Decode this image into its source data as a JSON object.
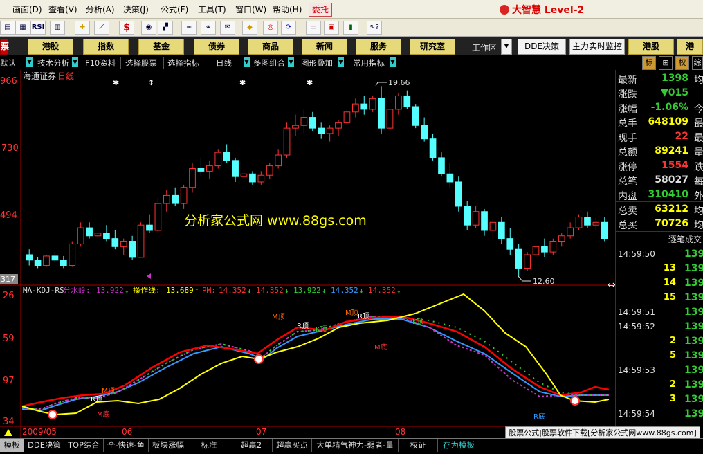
{
  "menu": {
    "items": [
      "画面(D)",
      "查看(V)",
      "分析(A)",
      "决策(J)",
      "公式(F)",
      "工具(T)",
      "窗口(W)",
      "帮助(H)"
    ],
    "weituo": "委托",
    "brand": "大智慧 Level-2"
  },
  "toolbar": {
    "icons": [
      "print-icon",
      "quote-icon",
      "rsi-icon",
      "grid-icon",
      "move-icon",
      "ruler-icon",
      "money-icon",
      "f10-icon",
      "pattern-icon",
      "binoculars-icon",
      "link-icon",
      "chat-icon",
      "stock-icon",
      "diamond-icon",
      "target-icon",
      "refresh-icon",
      "pad-icon",
      "panel-icon",
      "books-icon",
      "pointer-help-icon"
    ],
    "labels": {
      "rsi": "RSI",
      "money": "$"
    }
  },
  "nav": {
    "left_stub": "票",
    "buttons": [
      "港股",
      "指数",
      "基金",
      "债券",
      "商品",
      "新闻",
      "服务",
      "研究室"
    ],
    "workspace_label": "工作区",
    "dde": "DDE决策",
    "monitor": "主力实时监控",
    "hk": "港股",
    "hk2": "港"
  },
  "subbar": {
    "items": [
      "默认",
      "技术分析",
      "F10资料",
      "选择股票",
      "选择指标",
      "日线",
      "多图组合",
      "图形叠加",
      "常用指标"
    ],
    "right": [
      "标",
      "⊞",
      "权",
      "综"
    ]
  },
  "chart": {
    "title": "海通证券",
    "period": "日线",
    "price_ticks": [
      "966",
      "730",
      "494",
      "317"
    ],
    "kdj_ticks": [
      "26",
      "59",
      "97",
      "34"
    ],
    "date_labels": [
      "2009/05",
      "06",
      "07",
      "08"
    ],
    "high_label": "19.66",
    "low_label": "12.60",
    "watermark": "分析家公式网 www.88gs.com",
    "indicator_name": "MA-KDJ-RS",
    "indicator_vals": [
      {
        "label": "分水岭:",
        "value": "13.922",
        "arrow": "↓",
        "color": "#c3c"
      },
      {
        "label": "操作线:",
        "value": "13.689",
        "arrow": "↑",
        "color": "#ff0"
      },
      {
        "label": "PM:",
        "value": "14.352",
        "arrow": "↓",
        "color": "#f33"
      },
      {
        "label": "",
        "value": "14.352",
        "arrow": "↓",
        "color": "#f33"
      },
      {
        "label": "",
        "value": "13.922",
        "arrow": "↓",
        "color": "#3c3"
      },
      {
        "label": "",
        "value": "14.352",
        "arrow": "↓",
        "color": "#39f"
      },
      {
        "label": "",
        "value": "14.352",
        "arrow": "↓",
        "color": "#f33"
      }
    ],
    "annotations": [
      "M顶",
      "R顶",
      "K顶",
      "M顶",
      "R顶",
      "K顶",
      "M底",
      "R底",
      "M底",
      "R顶",
      "M顶"
    ],
    "chart_data": {
      "type": "candlestick",
      "title": "海通证券 日线",
      "high": 19.66,
      "low": 12.6,
      "candles": [
        [
          13.4,
          13.6,
          13.0,
          13.2
        ],
        [
          13.2,
          13.3,
          12.9,
          13.0
        ],
        [
          13.0,
          13.4,
          12.95,
          13.35
        ],
        [
          13.35,
          13.5,
          13.1,
          13.2
        ],
        [
          13.2,
          13.35,
          12.9,
          13.0
        ],
        [
          13.0,
          13.9,
          12.95,
          13.8
        ],
        [
          13.8,
          14.6,
          13.7,
          14.4
        ],
        [
          14.4,
          14.6,
          14.0,
          14.1
        ],
        [
          14.1,
          14.3,
          13.8,
          14.2
        ],
        [
          14.2,
          14.5,
          13.9,
          14.0
        ],
        [
          14.0,
          14.3,
          13.6,
          13.7
        ],
        [
          13.7,
          14.0,
          13.4,
          13.9
        ],
        [
          13.9,
          14.1,
          13.2,
          13.3
        ],
        [
          13.3,
          14.6,
          13.3,
          14.5
        ],
        [
          14.5,
          14.9,
          14.2,
          14.3
        ],
        [
          14.3,
          15.5,
          14.2,
          15.3
        ],
        [
          15.3,
          15.8,
          15.0,
          15.6
        ],
        [
          15.6,
          15.9,
          15.2,
          15.3
        ],
        [
          15.3,
          16.0,
          15.1,
          15.9
        ],
        [
          15.9,
          16.8,
          15.7,
          16.6
        ],
        [
          16.6,
          17.0,
          16.3,
          16.5
        ],
        [
          16.5,
          16.9,
          16.2,
          16.7
        ],
        [
          16.7,
          17.3,
          16.6,
          17.2
        ],
        [
          17.2,
          17.5,
          16.8,
          16.9
        ],
        [
          16.9,
          17.0,
          16.1,
          16.3
        ],
        [
          16.3,
          16.6,
          16.0,
          16.4
        ],
        [
          16.4,
          16.5,
          16.0,
          16.1
        ],
        [
          16.1,
          16.5,
          16.0,
          16.35
        ],
        [
          16.35,
          16.8,
          16.2,
          16.7
        ],
        [
          16.7,
          17.3,
          16.6,
          17.1
        ],
        [
          17.1,
          18.3,
          17.0,
          18.1
        ],
        [
          18.1,
          18.6,
          17.8,
          18.2
        ],
        [
          18.2,
          18.8,
          17.9,
          18.5
        ],
        [
          18.5,
          18.7,
          18.0,
          18.1
        ],
        [
          18.1,
          18.3,
          17.7,
          17.9
        ],
        [
          17.9,
          18.2,
          17.6,
          18.1
        ],
        [
          18.1,
          18.4,
          17.8,
          18.3
        ],
        [
          18.3,
          18.8,
          18.2,
          18.7
        ],
        [
          18.7,
          19.2,
          18.5,
          19.0
        ],
        [
          19.0,
          19.3,
          18.6,
          18.8
        ],
        [
          18.8,
          19.3,
          18.7,
          19.2
        ],
        [
          19.2,
          19.66,
          17.9,
          18.1
        ],
        [
          18.1,
          18.9,
          18.0,
          18.8
        ],
        [
          18.8,
          19.4,
          18.6,
          19.3
        ],
        [
          19.3,
          19.5,
          18.8,
          18.9
        ],
        [
          18.9,
          19.0,
          18.1,
          18.2
        ],
        [
          18.2,
          18.5,
          17.6,
          17.7
        ],
        [
          17.7,
          17.9,
          16.9,
          17.0
        ],
        [
          17.0,
          17.2,
          16.3,
          16.4
        ],
        [
          16.4,
          16.8,
          15.9,
          16.1
        ],
        [
          16.1,
          16.3,
          15.0,
          15.2
        ],
        [
          15.2,
          15.4,
          14.3,
          14.5
        ],
        [
          14.5,
          15.2,
          14.4,
          15.0
        ],
        [
          15.0,
          15.1,
          14.1,
          14.3
        ],
        [
          14.3,
          14.7,
          14.0,
          14.6
        ],
        [
          14.6,
          14.8,
          13.8,
          14.0
        ],
        [
          14.0,
          14.4,
          13.4,
          13.6
        ],
        [
          13.6,
          13.8,
          12.6,
          12.9
        ],
        [
          12.9,
          13.5,
          12.8,
          13.4
        ],
        [
          13.4,
          13.8,
          13.2,
          13.7
        ],
        [
          13.7,
          14.0,
          13.3,
          13.5
        ],
        [
          13.5,
          14.0,
          13.4,
          13.9
        ],
        [
          13.9,
          14.2,
          13.7,
          14.1
        ],
        [
          14.1,
          14.6,
          14.0,
          14.4
        ],
        [
          14.4,
          14.9,
          14.3,
          14.8
        ],
        [
          14.8,
          15.0,
          14.4,
          14.5
        ],
        [
          14.5,
          14.8,
          14.3,
          14.6
        ],
        [
          14.6,
          14.8,
          13.9,
          14.0
        ]
      ]
    }
  },
  "quote": {
    "rows": [
      {
        "label": "最新",
        "value": "1398",
        "color": "#3c3",
        "extra": "均"
      },
      {
        "label": "涨跌",
        "value": "▼015",
        "color": "#3c3",
        "extra": ""
      },
      {
        "label": "涨幅",
        "value": "-1.06%",
        "color": "#3c3",
        "extra": "今"
      },
      {
        "label": "总手",
        "value": "648109",
        "color": "#ff0",
        "extra": "最"
      },
      {
        "label": "现手",
        "value": "22",
        "color": "#f33",
        "extra": "最"
      },
      {
        "label": "总额",
        "value": "89241",
        "color": "#ff0",
        "extra": "量"
      },
      {
        "label": "涨停",
        "value": "1554",
        "color": "#f33",
        "extra": "跌"
      },
      {
        "label": "总笔",
        "value": "58027",
        "color": "#ddd",
        "extra": "每"
      },
      {
        "label": "内盘",
        "value": "310410",
        "color": "#3c3",
        "extra": "外"
      },
      {
        "label": "总卖",
        "value": "63212",
        "color": "#ff0",
        "extra": "均"
      },
      {
        "label": "总买",
        "value": "70726",
        "color": "#ff0",
        "extra": "均"
      }
    ],
    "trades_title": "逐笔成交",
    "trades": [
      {
        "time": "14:59:50",
        "vol": "",
        "price": "139"
      },
      {
        "time": "",
        "vol": "13",
        "price": "139"
      },
      {
        "time": "",
        "vol": "14",
        "price": "139"
      },
      {
        "time": "",
        "vol": "15",
        "price": "139"
      },
      {
        "time": "14:59:51",
        "vol": "",
        "price": "139"
      },
      {
        "time": "14:59:52",
        "vol": "",
        "price": "139"
      },
      {
        "time": "",
        "vol": "2",
        "price": "139"
      },
      {
        "time": "",
        "vol": "5",
        "price": "139"
      },
      {
        "time": "14:59:53",
        "vol": "",
        "price": "139"
      },
      {
        "time": "",
        "vol": "2",
        "price": "139"
      },
      {
        "time": "",
        "vol": "3",
        "price": "139"
      },
      {
        "time": "14:59:54",
        "vol": "",
        "price": "139"
      }
    ]
  },
  "bottom": {
    "left": "模板",
    "tabs": [
      "DDE决策",
      "TOP综合",
      "全-快速-鱼",
      "板块涨幅",
      "标准",
      "超赢2",
      "超赢买点",
      "大单精气神力-弱者-量",
      "权证",
      "存为模板"
    ],
    "status": "股票公式|股票软件下载[分析家公式网www.88gs.com]"
  }
}
